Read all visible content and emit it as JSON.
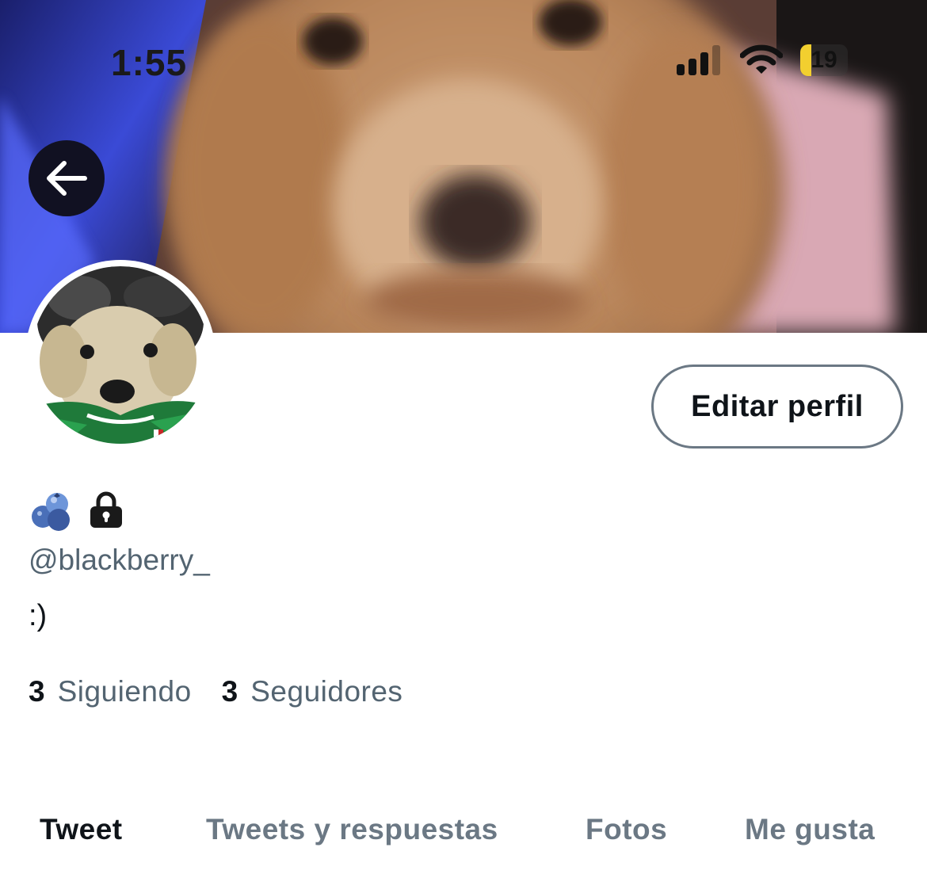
{
  "status_bar": {
    "time": "1:55",
    "battery_level": "19",
    "signal_icon": "cellular-signal-icon",
    "wifi_icon": "wifi-icon",
    "battery_icon": "battery-icon"
  },
  "header": {
    "back_icon": "arrow-left-icon"
  },
  "profile": {
    "display_name_emojis": [
      "blueberries-emoji",
      "lock-icon"
    ],
    "handle": "@blackberry_",
    "bio": ":)",
    "edit_button_label": "Editar perfil",
    "following_count": "3",
    "following_label": "Siguiendo",
    "followers_count": "3",
    "followers_label": "Seguidores"
  },
  "tabs": [
    {
      "label": "Tweet",
      "active": true
    },
    {
      "label": "Tweets y respuestas",
      "active": false
    },
    {
      "label": "Fotos",
      "active": false
    },
    {
      "label": "Me gusta",
      "active": false
    }
  ],
  "colors": {
    "text_primary": "#0f1419",
    "text_secondary": "#536471",
    "button_border": "#6b7884",
    "battery_low": "#f2cf2f"
  }
}
